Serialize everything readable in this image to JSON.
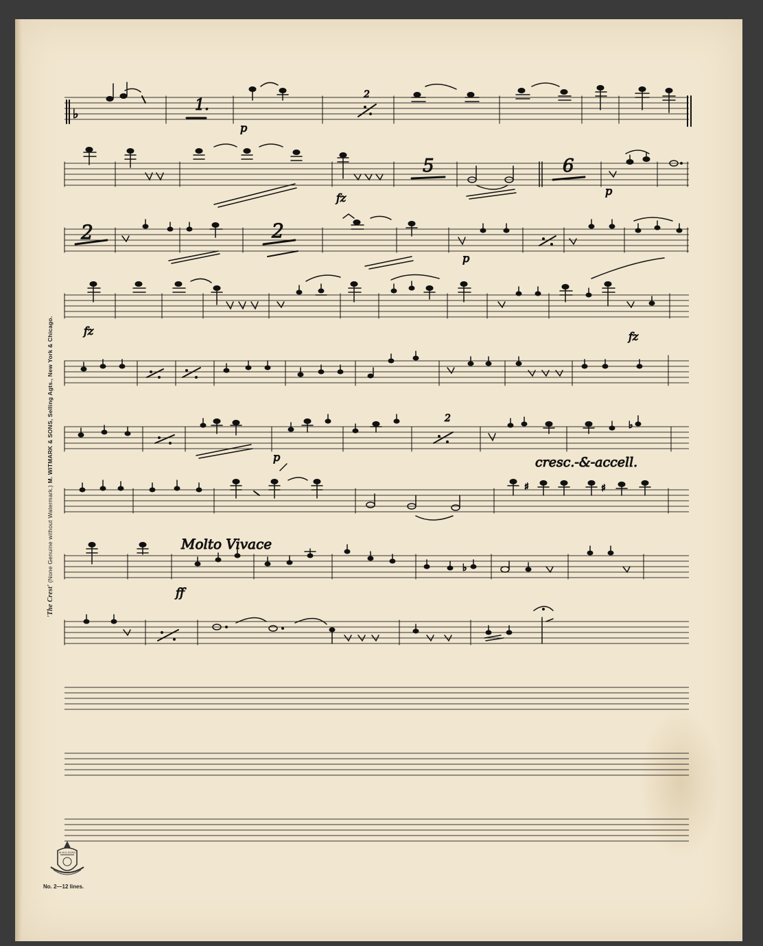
{
  "document": {
    "type": "handwritten music manuscript",
    "side_text": {
      "brand": "'The Crest'",
      "note": "(None Genuine without Watermark.)",
      "publisher": "M. WITMARK & SONS, Selling Agts., New York & Chicago."
    },
    "plate_number": "No. 2—12 lines.",
    "seal_label": "M.W.& SONS",
    "staff_count": 12,
    "filled_staff_count": 9,
    "annotations": {
      "dynamic_p_1": "p",
      "dynamic_p_2": "p",
      "dynamic_p_3": "p",
      "dynamic_p_4": "p",
      "dynamic_fz_1": "fz",
      "dynamic_fz_2": "fz",
      "dynamic_fz_3": "fz",
      "dynamic_ff": "ff",
      "tempo_cresc": "cresc.-&-accell.",
      "tempo_molto": "Molto Vivace",
      "rest_1": "1.",
      "rest_2": "2",
      "rest_5": "5",
      "rest_6": "6",
      "rest_2b": "2",
      "rest_2c": "2",
      "repeat_2": "2"
    },
    "colors": {
      "paper": "#f1e6cf",
      "ink": "#111111",
      "staff": "#333333",
      "background": "#3a3a3a"
    }
  }
}
